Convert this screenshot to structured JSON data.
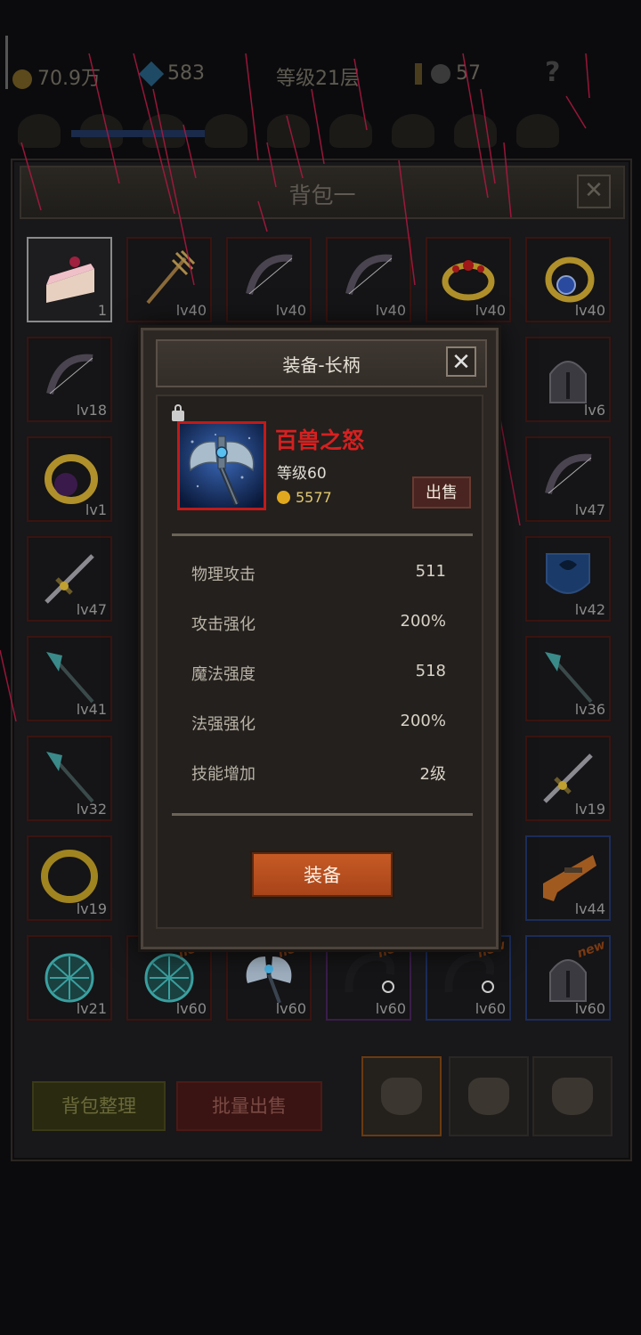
{
  "topbar": {
    "gold": "70.9万",
    "gems": "583",
    "level": "等级21层",
    "skulls": "57",
    "help": "?"
  },
  "bag": {
    "title": "背包一",
    "close": "✕",
    "sort_label": "背包整理",
    "batch_sell_label": "批量出售",
    "slots": [
      {
        "icon": "cake-icon",
        "count": "1"
      },
      {
        "icon": "trident-icon",
        "level": "lv40"
      },
      {
        "icon": "bow-icon",
        "level": "lv40"
      },
      {
        "icon": "bow-icon",
        "level": "lv40"
      },
      {
        "icon": "ruby-ring-icon",
        "level": "lv40"
      },
      {
        "icon": "sapphire-ring-icon",
        "level": "lv40"
      },
      {
        "icon": "bow-icon",
        "level": "lv18"
      },
      {
        "icon": "helmet-icon",
        "level": "lv6"
      },
      {
        "icon": "amethyst-ring-icon",
        "level": "lv1"
      },
      {
        "icon": "bow-icon",
        "level": "lv47"
      },
      {
        "icon": "sword-icon",
        "level": "lv47"
      },
      {
        "icon": "shield-icon",
        "level": "lv42"
      },
      {
        "icon": "spear-icon",
        "level": "lv41"
      },
      {
        "icon": "spear-icon",
        "level": "lv36"
      },
      {
        "icon": "spear-icon",
        "level": "lv32"
      },
      {
        "icon": "sword-icon",
        "level": "lv19"
      },
      {
        "icon": "gold-ring-icon",
        "level": "lv19"
      },
      {
        "icon": "gun-icon",
        "level": "lv44"
      },
      {
        "icon": "orb-icon",
        "level": "lv21"
      },
      {
        "icon": "orb-icon",
        "level": "lv60"
      },
      {
        "icon": "axe-icon",
        "level": "lv60"
      },
      {
        "icon": "chain-icon",
        "level": "lv60"
      },
      {
        "icon": "chain-icon",
        "level": "lv60"
      },
      {
        "icon": "helmet-icon",
        "level": "lv60"
      }
    ],
    "new_badge": "new"
  },
  "dialog": {
    "title": "装备-长柄",
    "close": "✕",
    "item_name": "百兽之怒",
    "item_level": "等级60",
    "price": "5577",
    "sell_label": "出售",
    "stats": [
      {
        "label": "物理攻击",
        "value": "511"
      },
      {
        "label": "攻击强化",
        "value": "200%"
      },
      {
        "label": "魔法强度",
        "value": "518"
      },
      {
        "label": "法强强化",
        "value": "200%"
      },
      {
        "label": "技能增加",
        "value": "2级"
      }
    ],
    "equip_label": "装备"
  },
  "colors": {
    "item_name": "#d62020",
    "equip_button": "#c65a24",
    "slot_border_red": "#3a1410",
    "slot_border_blue": "#1c2d5a"
  }
}
